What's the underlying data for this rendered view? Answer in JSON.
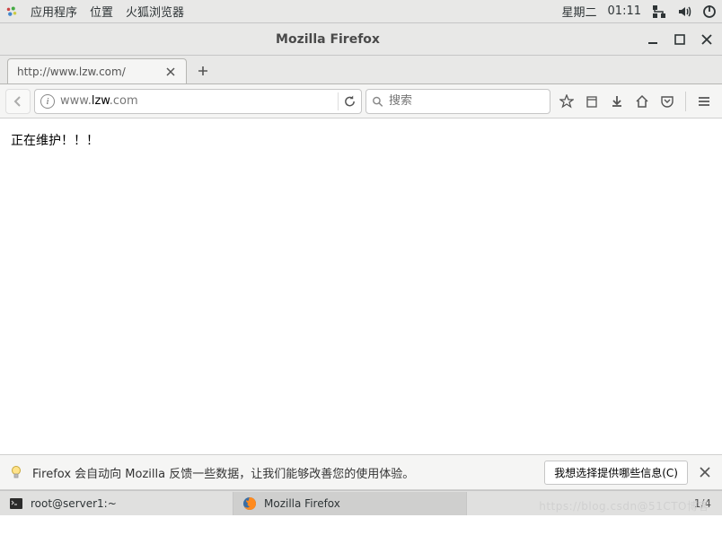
{
  "topbar": {
    "apps": "应用程序",
    "places": "位置",
    "fox": "火狐浏览器",
    "day": "星期二",
    "time": "01:11"
  },
  "window": {
    "title": "Mozilla Firefox"
  },
  "tab": {
    "title": "http://www.lzw.com/"
  },
  "address": {
    "prefix": "www.",
    "host": "lzw",
    "suffix": ".com"
  },
  "search": {
    "placeholder": "搜索"
  },
  "page": {
    "content": "正在维护！！！"
  },
  "notif": {
    "message": "Firefox 会自动向 Mozilla 反馈一些数据，让我们能够改善您的使用体验。",
    "button": "我想选择提供哪些信息(C)"
  },
  "taskbar": {
    "terminal": "root@server1:~",
    "firefox": "Mozilla Firefox",
    "workspace": "1/4"
  },
  "watermark": "https://blog.csdn@51CTO博客"
}
